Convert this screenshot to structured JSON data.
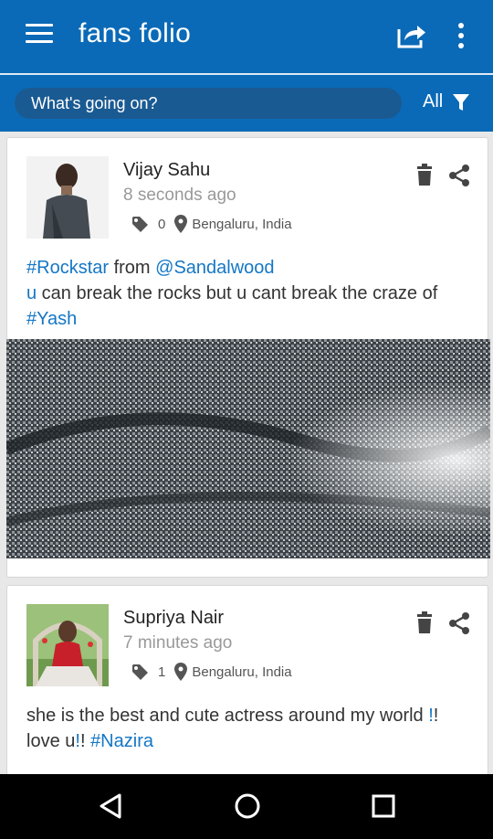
{
  "app": {
    "title": "fans folio"
  },
  "search": {
    "placeholder": "What's going on?"
  },
  "filter": {
    "label": "All"
  },
  "posts": [
    {
      "author": "Vijay Sahu",
      "time": "8 seconds ago",
      "tag_count": "0",
      "location": "Bengaluru, India",
      "text_parts": [
        "#Rockstar",
        " from ",
        "@Sandalwood",
        "u",
        " can break the rocks but u cant break the craze of ",
        "#Yash"
      ]
    },
    {
      "author": "Supriya Nair",
      "time": "7 minutes ago",
      "tag_count": "1",
      "location": "Bengaluru, India",
      "text_parts": [
        "she is the best and cute actress around my world ",
        "!",
        "! love u",
        "!",
        "! ",
        "#Nazira"
      ]
    }
  ],
  "colors": {
    "primary": "#0a6ab7",
    "link": "#1477c5"
  }
}
